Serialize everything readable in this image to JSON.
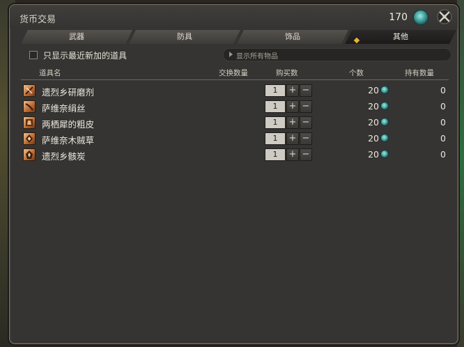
{
  "window": {
    "title": "货币交易",
    "currency_count": "170"
  },
  "tabs": [
    {
      "label": "武器",
      "active": false
    },
    {
      "label": "防具",
      "active": false
    },
    {
      "label": "饰品",
      "active": false
    },
    {
      "label": "其他",
      "active": true
    }
  ],
  "filter": {
    "checkbox_label": "只显示最近新加的道具",
    "dropdown_value": "显示所有物品"
  },
  "columns": {
    "name": "道具名",
    "exchange_qty": "交换数量",
    "buy_qty": "购买数",
    "count": "个数",
    "held": "持有数量"
  },
  "items": [
    {
      "name": "遗烈乡研磨剂",
      "qty": "1",
      "price": "20",
      "held": "0",
      "icon": "grinding-agent-icon"
    },
    {
      "name": "萨维奈绢丝",
      "qty": "1",
      "price": "20",
      "held": "0",
      "icon": "silk-thread-icon"
    },
    {
      "name": "两栖犀的粗皮",
      "qty": "1",
      "price": "20",
      "held": "0",
      "icon": "rough-hide-icon"
    },
    {
      "name": "萨维奈木贼草",
      "qty": "1",
      "price": "20",
      "held": "0",
      "icon": "horsetail-icon"
    },
    {
      "name": "遗烈乡骸炭",
      "qty": "1",
      "price": "20",
      "held": "0",
      "icon": "charcoal-icon"
    }
  ],
  "buttons": {
    "plus": "+",
    "minus": "−"
  },
  "colors": {
    "panel": "#353432",
    "tab_active": "#1c1b1a",
    "accent_gem": "#3d9c9a",
    "tab_marker": "#e8b33a"
  }
}
